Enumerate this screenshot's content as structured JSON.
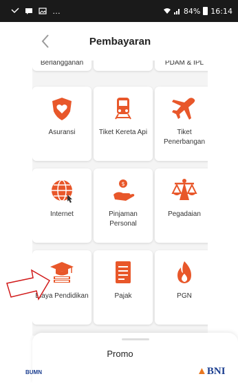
{
  "status_bar": {
    "left": "…",
    "battery": "84%",
    "time": "16:14"
  },
  "header": {
    "title": "Pembayaran",
    "back_icon": "chevron-left-icon"
  },
  "colors": {
    "accent": "#e8572a",
    "card_bg": "#ffffff",
    "grid_bg": "#f4f4f4",
    "bni_blue": "#1a3d8f"
  },
  "grid": {
    "row0": [
      "Berlangganan",
      "",
      "PDAM & IPL"
    ],
    "items": [
      {
        "name": "Asuransi",
        "icon": "shield-heart-icon"
      },
      {
        "name": "Tiket Kereta Api",
        "icon": "train-icon"
      },
      {
        "name": "Tiket Penerbangan",
        "icon": "airplane-icon"
      },
      {
        "name": "Internet",
        "icon": "globe-icon"
      },
      {
        "name": "Pinjaman Personal",
        "icon": "loan-hand-icon"
      },
      {
        "name": "Pegadaian",
        "icon": "scale-icon"
      },
      {
        "name": "Biaya Pendidikan",
        "icon": "graduation-cap-icon"
      },
      {
        "name": "Pajak",
        "icon": "tax-document-icon"
      },
      {
        "name": "PGN",
        "icon": "flame-icon"
      }
    ]
  },
  "promo": {
    "title": "Promo",
    "logos": [
      "BUMN",
      "BNI"
    ]
  }
}
